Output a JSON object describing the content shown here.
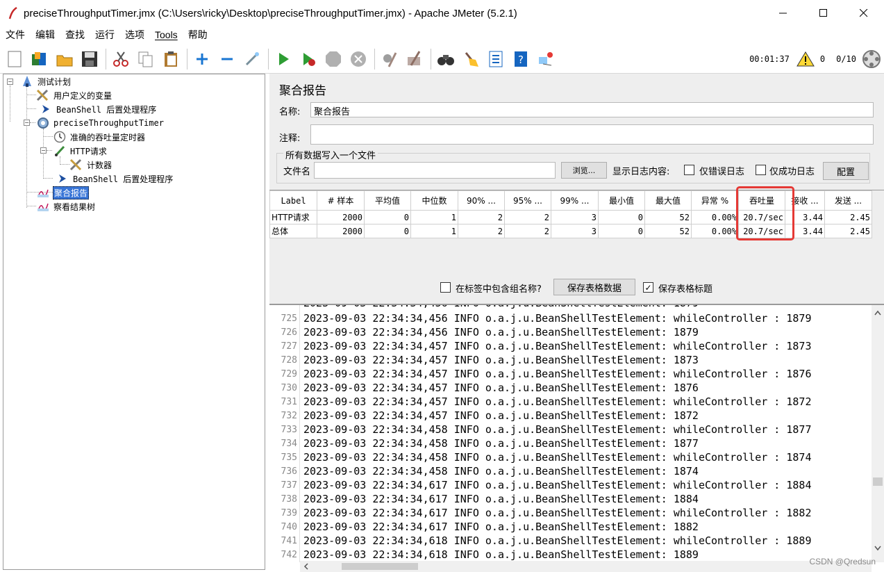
{
  "window": {
    "title": "preciseThroughputTimer.jmx (C:\\Users\\ricky\\Desktop\\preciseThroughputTimer.jmx) - Apache JMeter (5.2.1)"
  },
  "menu": [
    "文件",
    "编辑",
    "查找",
    "运行",
    "选项",
    "Tools",
    "帮助"
  ],
  "status": {
    "elapsed": "00:01:37",
    "warnings": "0",
    "threads": "0/10"
  },
  "tree": [
    {
      "label": "测试计划",
      "icon": "test-plan-icon"
    },
    {
      "label": "用户定义的变量",
      "icon": "config-wrench-icon"
    },
    {
      "label": "BeanShell 后置处理程序",
      "icon": "post-processor-arrow-icon"
    },
    {
      "label": "preciseThroughputTimer",
      "icon": "thread-group-gear-icon"
    },
    {
      "label": "准确的吞吐量定时器",
      "icon": "timer-clock-icon"
    },
    {
      "label": "HTTP请求",
      "icon": "sampler-pen-icon"
    },
    {
      "label": "计数器",
      "icon": "config-wrench-icon"
    },
    {
      "label": "BeanShell 后置处理程序",
      "icon": "post-processor-arrow-icon"
    },
    {
      "label": "聚合报告",
      "icon": "listener-chart-icon"
    },
    {
      "label": "察看结果树",
      "icon": "listener-chart-icon"
    }
  ],
  "panel": {
    "title": "聚合报告",
    "name_label": "名称:",
    "name_value": "聚合报告",
    "comment_label": "注释:",
    "comment_value": "",
    "file_group_legend": "所有数据写入一个文件",
    "file_label": "文件名",
    "file_value": "",
    "browse_button": "浏览...",
    "log_display_label": "显示日志内容:",
    "errors_only_label": "仅错误日志",
    "success_only_label": "仅成功日志",
    "configure_button": "配置",
    "include_group_label": "在标签中包含组名称?",
    "save_table_button": "保存表格数据",
    "save_header_label": "保存表格标题"
  },
  "table": {
    "headers": [
      "Label",
      "# 样本",
      "平均值",
      "中位数",
      "90% ...",
      "95% ...",
      "99% ...",
      "最小值",
      "最大值",
      "异常 %",
      "吞吐量",
      "接收 ...",
      "发送 ..."
    ],
    "rows": [
      [
        "HTTP请求",
        "2000",
        "0",
        "1",
        "2",
        "2",
        "3",
        "0",
        "52",
        "0.00%",
        "20.7/sec",
        "3.44",
        "2.45"
      ],
      [
        "总体",
        "2000",
        "0",
        "1",
        "2",
        "2",
        "3",
        "0",
        "52",
        "0.00%",
        "20.7/sec",
        "3.44",
        "2.45"
      ]
    ]
  },
  "log": {
    "lines": [
      {
        "n": "725",
        "text": "2023-09-03 22:34:34,456 INFO o.a.j.u.BeanShellTestElement: whileController : 1879"
      },
      {
        "n": "726",
        "text": "2023-09-03 22:34:34,456 INFO o.a.j.u.BeanShellTestElement: 1879"
      },
      {
        "n": "727",
        "text": "2023-09-03 22:34:34,457 INFO o.a.j.u.BeanShellTestElement: whileController : 1873"
      },
      {
        "n": "728",
        "text": "2023-09-03 22:34:34,457 INFO o.a.j.u.BeanShellTestElement: 1873"
      },
      {
        "n": "729",
        "text": "2023-09-03 22:34:34,457 INFO o.a.j.u.BeanShellTestElement: whileController : 1876"
      },
      {
        "n": "730",
        "text": "2023-09-03 22:34:34,457 INFO o.a.j.u.BeanShellTestElement: 1876"
      },
      {
        "n": "731",
        "text": "2023-09-03 22:34:34,457 INFO o.a.j.u.BeanShellTestElement: whileController : 1872"
      },
      {
        "n": "732",
        "text": "2023-09-03 22:34:34,457 INFO o.a.j.u.BeanShellTestElement: 1872"
      },
      {
        "n": "733",
        "text": "2023-09-03 22:34:34,458 INFO o.a.j.u.BeanShellTestElement: whileController : 1877"
      },
      {
        "n": "734",
        "text": "2023-09-03 22:34:34,458 INFO o.a.j.u.BeanShellTestElement: 1877"
      },
      {
        "n": "735",
        "text": "2023-09-03 22:34:34,458 INFO o.a.j.u.BeanShellTestElement: whileController : 1874"
      },
      {
        "n": "736",
        "text": "2023-09-03 22:34:34,458 INFO o.a.j.u.BeanShellTestElement: 1874"
      },
      {
        "n": "737",
        "text": "2023-09-03 22:34:34,617 INFO o.a.j.u.BeanShellTestElement: whileController : 1884"
      },
      {
        "n": "738",
        "text": "2023-09-03 22:34:34,617 INFO o.a.j.u.BeanShellTestElement: 1884"
      },
      {
        "n": "739",
        "text": "2023-09-03 22:34:34,617 INFO o.a.j.u.BeanShellTestElement: whileController : 1882"
      },
      {
        "n": "740",
        "text": "2023-09-03 22:34:34,617 INFO o.a.j.u.BeanShellTestElement: 1882"
      },
      {
        "n": "741",
        "text": "2023-09-03 22:34:34,618 INFO o.a.j.u.BeanShellTestElement: whileController : 1889"
      },
      {
        "n": "742",
        "text": "2023-09-03 22:34:34,618 INFO o.a.j.u.BeanShellTestElement: 1889"
      }
    ]
  },
  "watermark": "CSDN @Qredsun",
  "colors": {
    "selection": "#3875d7",
    "highlight": "#e53935",
    "panel_bg": "#eeeeee"
  }
}
